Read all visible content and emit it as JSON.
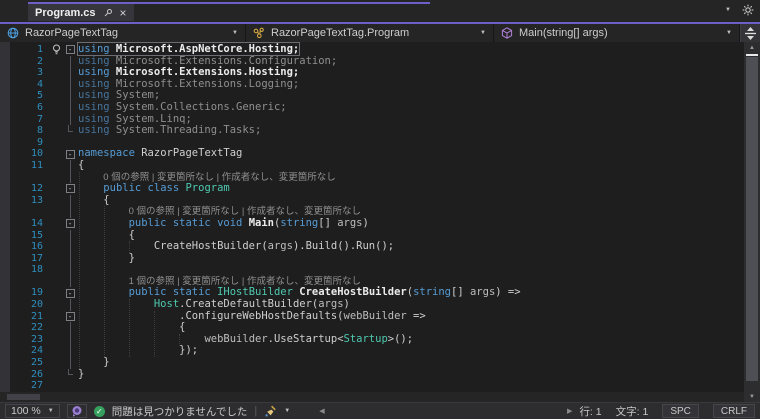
{
  "tab": {
    "title": "Program.cs"
  },
  "navbar": {
    "project": "RazorPageTextTag",
    "type": "RazorPageTextTag.Program",
    "member": "Main(string[] args)"
  },
  "icons": {
    "caret": "▼",
    "up": "▲",
    "down": "▼",
    "left": "◀",
    "right": "▶",
    "close": "×",
    "check": "✓",
    "project_icon": "globe-icon",
    "type_icon": "class-icon",
    "member_icon": "method-cube-icon",
    "gear": "gear-icon",
    "pin": "pin-icon",
    "bulb": "lightbulb-icon",
    "broom": "code-cleanup-broom-icon",
    "purple": "purple-indicator-icon",
    "split": "split-window-icon"
  },
  "status": {
    "zoom": "100 %",
    "health_message": "問題は見つかりませんでした",
    "separator": "|",
    "line": "行: 1",
    "char": "文字: 1",
    "space_mode": "SPC",
    "eol_mode": "CRLF"
  },
  "colors": {
    "accent": "#6C5FC7",
    "editor_bg": "#1E1E1E",
    "ui_bg": "#252526",
    "panel_bg": "#2D2D30",
    "keyword": "#569CD6",
    "type": "#4EC9B0",
    "line_number": "#2E8FBF",
    "dim_text": "#8F8F8F",
    "dim_keyword": "#46749C",
    "code_text": "#CFCFCF",
    "bright_text": "#ECECEC",
    "parameter": "#BDBDBD",
    "codelens": "#8F8F8F",
    "status_ok_green": "#37A05E"
  },
  "editor": {
    "rows": [
      {
        "n": "1",
        "fold": "open",
        "bulb": true,
        "cur": true,
        "seg": [
          [
            "k",
            "using"
          ],
          [
            "bu",
            " Microsoft.AspNetCore.Hosting;"
          ]
        ]
      },
      {
        "n": "2",
        "fold": "line",
        "seg": [
          [
            "kd",
            "using"
          ],
          [
            "d",
            " Microsoft.Extensions.Configuration;"
          ]
        ]
      },
      {
        "n": "3",
        "fold": "line",
        "seg": [
          [
            "k",
            "using"
          ],
          [
            "bu",
            " Microsoft.Extensions.Hosting;"
          ]
        ]
      },
      {
        "n": "4",
        "fold": "line",
        "seg": [
          [
            "kd",
            "using"
          ],
          [
            "d",
            " Microsoft.Extensions.Logging;"
          ]
        ]
      },
      {
        "n": "5",
        "fold": "line",
        "seg": [
          [
            "kd",
            "using"
          ],
          [
            "d",
            " System;"
          ]
        ]
      },
      {
        "n": "6",
        "fold": "line",
        "seg": [
          [
            "kd",
            "using"
          ],
          [
            "d",
            " System.Collections.Generic;"
          ]
        ]
      },
      {
        "n": "7",
        "fold": "line",
        "seg": [
          [
            "kd",
            "using"
          ],
          [
            "d",
            " System.Linq;"
          ]
        ]
      },
      {
        "n": "8",
        "fold": "end",
        "seg": [
          [
            "kd",
            "using"
          ],
          [
            "d",
            " System.Threading.Tasks;"
          ]
        ]
      },
      {
        "n": "9",
        "seg": []
      },
      {
        "n": "10",
        "fold": "open",
        "seg": [
          [
            "k",
            "namespace"
          ],
          [
            "n",
            " RazorPageTextTag"
          ]
        ]
      },
      {
        "n": "11",
        "fold": "line",
        "seg": [
          [
            "n",
            "{"
          ]
        ]
      },
      {
        "lens": true,
        "fold": "line",
        "indent": 4,
        "text": "0 個の参照 | 変更箇所なし | 作成者なし、変更箇所なし"
      },
      {
        "n": "12",
        "fold": "open",
        "seg": [
          [
            "n",
            "    "
          ],
          [
            "k",
            "public class "
          ],
          [
            "t",
            "Program"
          ]
        ]
      },
      {
        "n": "13",
        "fold": "line",
        "seg": [
          [
            "n",
            "    {"
          ]
        ]
      },
      {
        "lens": true,
        "fold": "line",
        "indent": 8,
        "text": "0 個の参照 | 変更箇所なし | 作成者なし、変更箇所なし"
      },
      {
        "n": "14",
        "fold": "open",
        "seg": [
          [
            "n",
            "        "
          ],
          [
            "k",
            "public static void "
          ],
          [
            "m",
            "Main"
          ],
          [
            "n",
            "("
          ],
          [
            "k",
            "string"
          ],
          [
            "n",
            "[] "
          ],
          [
            "a",
            "args"
          ],
          [
            "n",
            ")"
          ]
        ]
      },
      {
        "n": "15",
        "fold": "line",
        "seg": [
          [
            "n",
            "        {"
          ]
        ]
      },
      {
        "n": "16",
        "fold": "line",
        "seg": [
          [
            "n",
            "            CreateHostBuilder("
          ],
          [
            "a",
            "args"
          ],
          [
            "n",
            ").Build().Run();"
          ]
        ]
      },
      {
        "n": "17",
        "fold": "line",
        "seg": [
          [
            "n",
            "        }"
          ]
        ]
      },
      {
        "n": "18",
        "fold": "line",
        "seg": []
      },
      {
        "lens": true,
        "fold": "line",
        "indent": 8,
        "text": "1 個の参照 | 変更箇所なし | 作成者なし、変更箇所なし"
      },
      {
        "n": "19",
        "fold": "open",
        "seg": [
          [
            "n",
            "        "
          ],
          [
            "k",
            "public static "
          ],
          [
            "t",
            "IHostBuilder"
          ],
          [
            "n",
            " "
          ],
          [
            "m",
            "CreateHostBuilder"
          ],
          [
            "n",
            "("
          ],
          [
            "k",
            "string"
          ],
          [
            "n",
            "[] "
          ],
          [
            "a",
            "args"
          ],
          [
            "n",
            ") =>"
          ]
        ]
      },
      {
        "n": "20",
        "fold": "line",
        "seg": [
          [
            "n",
            "            "
          ],
          [
            "t",
            "Host"
          ],
          [
            "n",
            ".CreateDefaultBuilder("
          ],
          [
            "a",
            "args"
          ],
          [
            "n",
            ")"
          ]
        ]
      },
      {
        "n": "21",
        "fold": "open",
        "seg": [
          [
            "n",
            "                .ConfigureWebHostDefaults("
          ],
          [
            "a",
            "webBuilder"
          ],
          [
            "n",
            " =>"
          ]
        ]
      },
      {
        "n": "22",
        "fold": "line",
        "seg": [
          [
            "n",
            "                {"
          ]
        ]
      },
      {
        "n": "23",
        "fold": "line",
        "seg": [
          [
            "n",
            "                    "
          ],
          [
            "a",
            "webBuilder"
          ],
          [
            "n",
            ".UseStartup<"
          ],
          [
            "t",
            "Startup"
          ],
          [
            "n",
            ">();"
          ]
        ]
      },
      {
        "n": "24",
        "fold": "line",
        "seg": [
          [
            "n",
            "                });"
          ]
        ]
      },
      {
        "n": "25",
        "fold": "line",
        "seg": [
          [
            "n",
            "    }"
          ]
        ]
      },
      {
        "n": "26",
        "fold": "end",
        "seg": [
          [
            "n",
            "}"
          ]
        ]
      },
      {
        "n": "27",
        "seg": []
      }
    ]
  }
}
